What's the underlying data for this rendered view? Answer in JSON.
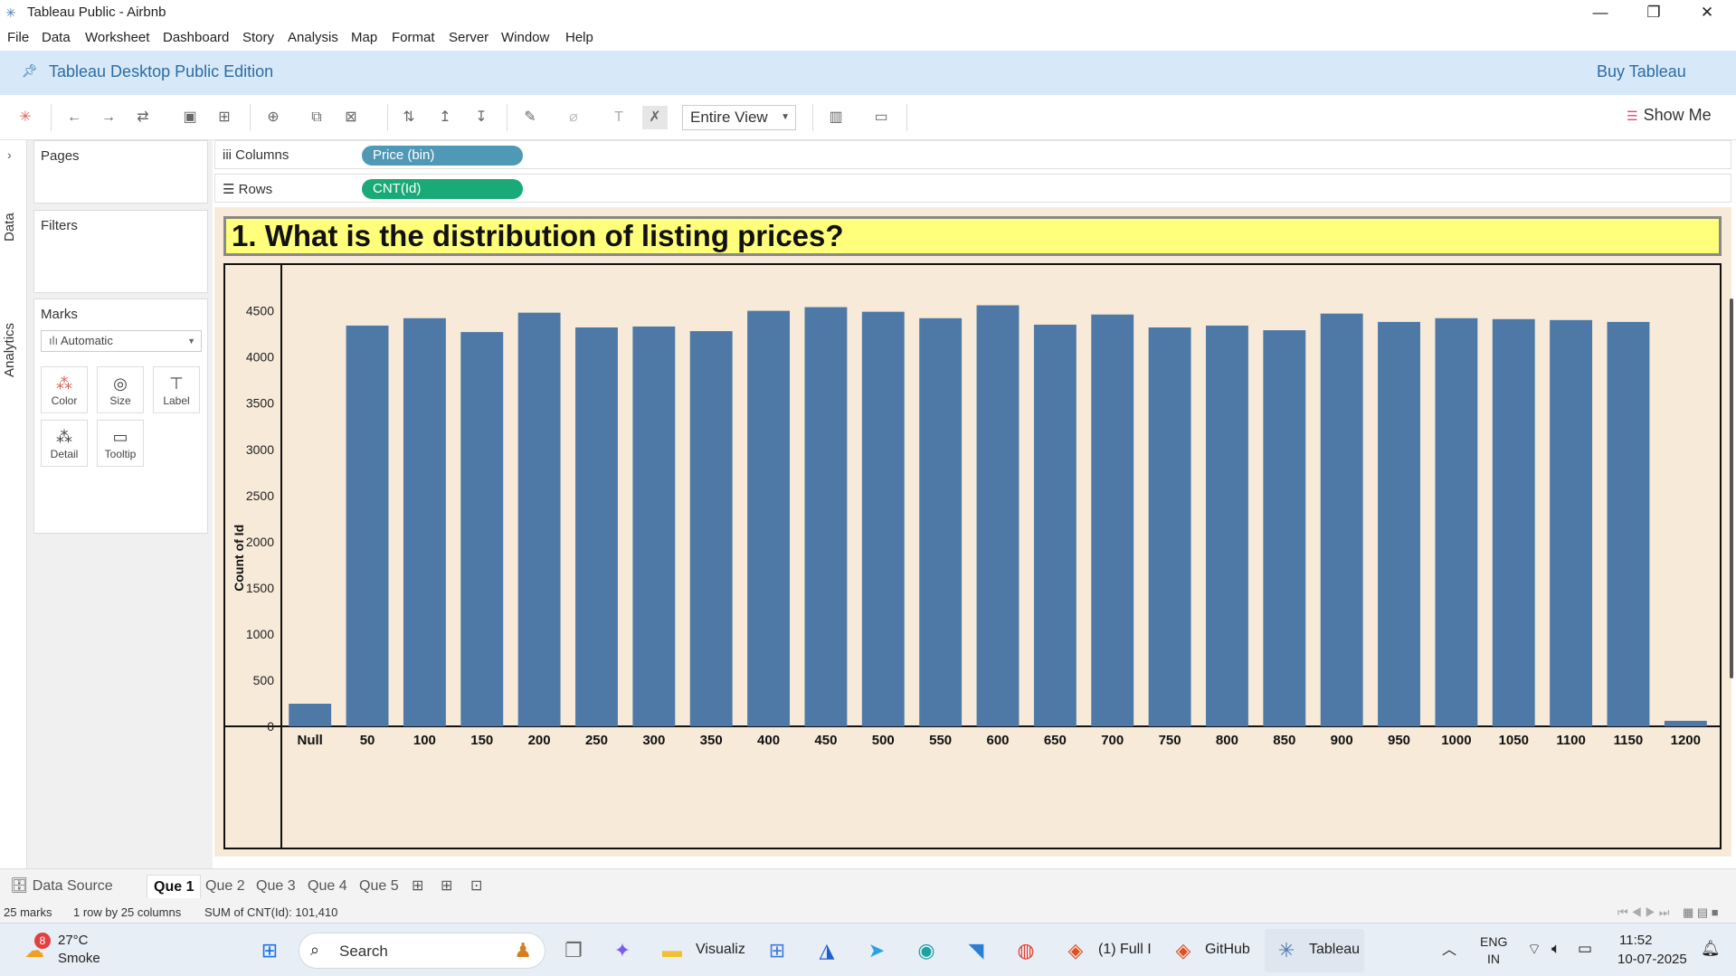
{
  "window": {
    "title": "Tableau Public - Airbnb",
    "minimize": "—",
    "maximize": "❐",
    "close": "✕"
  },
  "menu": [
    "File",
    "Data",
    "Worksheet",
    "Dashboard",
    "Story",
    "Analysis",
    "Map",
    "Format",
    "Server",
    "Window",
    "Help"
  ],
  "banner": {
    "edition": "Tableau Desktop Public Edition",
    "buy": "Buy Tableau"
  },
  "toolbar": {
    "fit": "Entire View",
    "show_me": "Show Me"
  },
  "side_tabs": {
    "data": "Data",
    "analytics": "Analytics"
  },
  "panels": {
    "pages": "Pages",
    "filters": "Filters",
    "marks": "Marks",
    "mark_type": "Automatic",
    "mark_buttons": [
      "Color",
      "Size",
      "Label",
      "Detail",
      "Tooltip"
    ]
  },
  "shelves": {
    "columns_label": "Columns",
    "columns_pill": "Price (bin)",
    "rows_label": "Rows",
    "rows_pill": "CNT(Id)"
  },
  "viz_title": "1. What is the distribution of listing prices?",
  "chart_data": {
    "type": "bar",
    "ylabel": "Count of Id",
    "xlabel": "",
    "ylim": [
      0,
      4800
    ],
    "yticks": [
      0,
      500,
      1000,
      1500,
      2000,
      2500,
      3000,
      3500,
      4000,
      4500
    ],
    "categories": [
      "Null",
      "50",
      "100",
      "150",
      "200",
      "250",
      "300",
      "350",
      "400",
      "450",
      "500",
      "550",
      "600",
      "650",
      "700",
      "750",
      "800",
      "850",
      "900",
      "950",
      "1000",
      "1050",
      "1100",
      "1150",
      "1200"
    ],
    "values": [
      245,
      4340,
      4420,
      4270,
      4480,
      4320,
      4330,
      4280,
      4500,
      4540,
      4490,
      4420,
      4560,
      4350,
      4460,
      4320,
      4340,
      4290,
      4470,
      4380,
      4420,
      4410,
      4400,
      4380,
      60
    ],
    "bar_color": "#4e79a7",
    "background": "#f7ead8",
    "grid": false
  },
  "sheet_tabs": {
    "data_source": "Data Source",
    "tabs": [
      "Que 1",
      "Que 2",
      "Que 3",
      "Que 4",
      "Que 5"
    ],
    "active": "Que 1"
  },
  "status": {
    "marks": "25 marks",
    "rows_cols": "1 row by 25 columns",
    "sum": "SUM of CNT(Id): 101,410"
  },
  "taskbar": {
    "weather_temp": "27°C",
    "weather_desc": "Smoke",
    "weather_badge": "8",
    "search": "Search",
    "apps": [
      "Visualiz",
      "(1) Full I",
      "GitHub",
      "Tableau"
    ],
    "lang1": "ENG",
    "lang2": "IN",
    "time": "11:52",
    "date": "10-07-2025"
  }
}
